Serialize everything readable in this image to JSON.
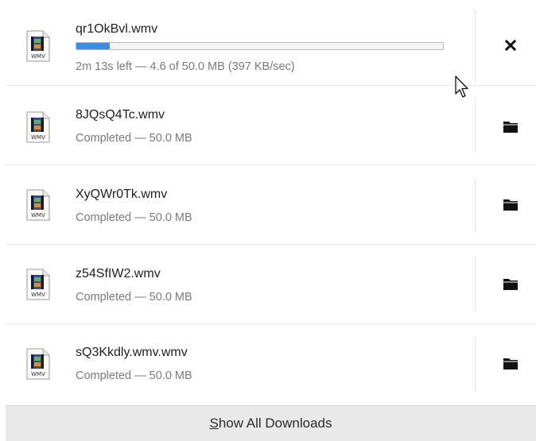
{
  "downloads": [
    {
      "filename": "qr1OkBvl.wmv",
      "status": "2m 13s left — 4.6 of 50.0 MB (397 KB/sec)",
      "in_progress": true,
      "progress": 0.092,
      "action": "cancel-icon",
      "icon_label": "WMV"
    },
    {
      "filename": "8JQsQ4Tc.wmv",
      "status": "Completed — 50.0 MB",
      "in_progress": false,
      "action": "folder-icon",
      "icon_label": "WMV"
    },
    {
      "filename": "XyQWr0Tk.wmv",
      "status": "Completed — 50.0 MB",
      "in_progress": false,
      "action": "folder-icon",
      "icon_label": "WMV"
    },
    {
      "filename": "z54SfIW2.wmv",
      "status": "Completed — 50.0 MB",
      "in_progress": false,
      "action": "folder-icon",
      "icon_label": "WMV"
    },
    {
      "filename": "sQ3Kkdly.wmv.wmv",
      "status": "Completed — 50.0 MB",
      "in_progress": false,
      "action": "folder-icon",
      "icon_label": "WMV"
    }
  ],
  "footer": {
    "show_all_first": "S",
    "show_all_rest": "how All Downloads"
  },
  "colors": {
    "progress_fill": "#3a8ee6",
    "footer_bg": "#e9e9e9"
  }
}
